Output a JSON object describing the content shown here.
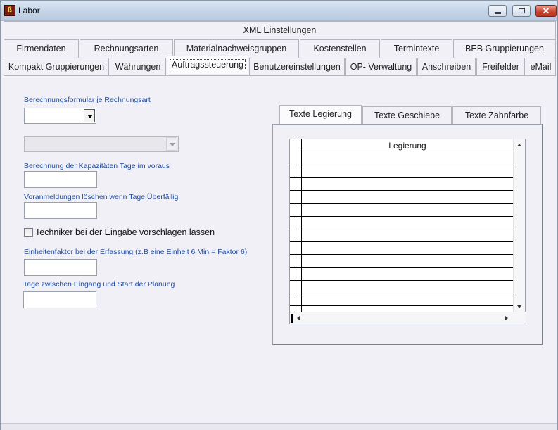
{
  "window": {
    "title": "Labor",
    "app_icon_glyph": "ß",
    "controls": {
      "minimize": "minimize-icon",
      "maximize": "maximize-icon",
      "close": "close-icon"
    }
  },
  "tabs": {
    "top": "XML Einstellungen",
    "row2": [
      "Firmendaten",
      "Rechnungsarten",
      "Materialnachweisgruppen",
      "Kostenstellen",
      "Termintexte",
      "BEB Gruppierungen"
    ],
    "row3": [
      "Kompakt Gruppierungen",
      "Währungen",
      "Auftragssteuerung",
      "Benutzereinstellungen",
      "OP- Verwaltung",
      "Anschreiben",
      "Freifelder",
      "eMail"
    ],
    "active": "Auftragssteuerung"
  },
  "form": {
    "berechnungsformular_label": "Berechnungsformular je Rechnungsart",
    "berechnungsformular_value": "",
    "disabled_combo_value": "",
    "kapazitaeten_label": "Berechnung der Kapazitäten Tage im voraus",
    "kapazitaeten_value": "",
    "voranmeldungen_label": "Voranmeldungen löschen wenn Tage Überfällig",
    "voranmeldungen_value": "",
    "techniker_label": "Techniker bei der Eingabe vorschlagen lassen",
    "techniker_checked": false,
    "einheitenfaktor_label": "Einheitenfaktor bei der Erfassung (z.B eine Einheit 6 Min = Faktor 6)",
    "einheitenfaktor_value": "",
    "tage_label": "Tage zwischen Eingang und Start der Planung",
    "tage_value": ""
  },
  "texte_panel": {
    "tabs": [
      "Texte Legierung",
      "Texte Geschiebe",
      "Texte Zahnfarbe"
    ],
    "active": "Texte Legierung",
    "grid_header": "Legierung",
    "rows": [
      "",
      "",
      "",
      "",
      "",
      "",
      "",
      "",
      "",
      "",
      "",
      ""
    ]
  },
  "colors": {
    "label_blue": "#1f4a9c",
    "window_bg": "#f1f0f7"
  }
}
